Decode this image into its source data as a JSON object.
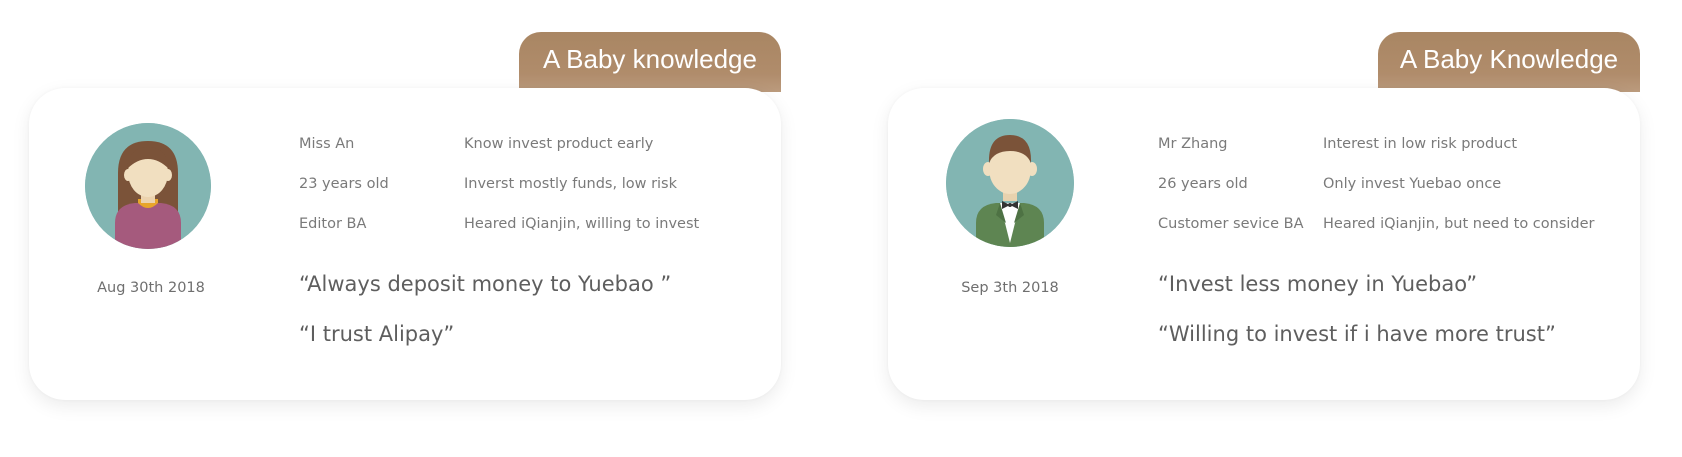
{
  "personas": [
    {
      "tag": "A Baby knowledge",
      "name": "Miss An",
      "age": "23 years old",
      "job": "Editor  BA",
      "traits": [
        "Know invest product early",
        "Inverst mostly funds, low risk",
        "Heared iQianjin, willing to invest"
      ],
      "date": "Aug 30th 2018",
      "quotes": [
        "“Always deposit money to Yuebao ”",
        "“I trust Alipay”"
      ],
      "avatar_icon": "woman-avatar-icon"
    },
    {
      "tag": "A Baby Knowledge",
      "name": "Mr Zhang",
      "age": "26 years old",
      "job": "Customer sevice  BA",
      "traits": [
        "Interest in low risk product",
        "Only invest Yuebao once",
        "Heared iQianjin, but need to consider"
      ],
      "date": "Sep  3th 2018",
      "quotes": [
        "“Invest less money in Yuebao”",
        "“Willing to invest if i have more trust”"
      ],
      "avatar_icon": "man-avatar-icon"
    }
  ],
  "colors": {
    "tag_brown": "#a98663",
    "avatar_teal": "#82b5b2",
    "text_gray": "#7a7a7a",
    "quote_gray": "#5e5e5e"
  }
}
